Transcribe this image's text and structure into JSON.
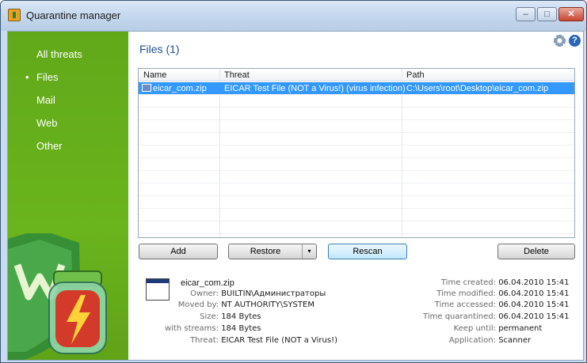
{
  "window": {
    "title": "Quarantine manager",
    "min": "–",
    "max": "□",
    "close": "✕"
  },
  "sidebar": {
    "items": [
      {
        "label": "All threats"
      },
      {
        "label": "Files",
        "bullet": "•"
      },
      {
        "label": "Mail"
      },
      {
        "label": "Web"
      },
      {
        "label": "Other"
      }
    ]
  },
  "main": {
    "title": "Files (1)",
    "help": "?",
    "columns": [
      "Name",
      "Threat",
      "Path"
    ],
    "rows": [
      {
        "name": "eicar_com.zip",
        "threat": "EICAR Test File (NOT a Virus!) (virus infection)",
        "path": "C:\\Users\\root\\Desktop\\eicar_com.zip"
      }
    ],
    "buttons": {
      "add": "Add",
      "restore": "Restore",
      "restore_arrow": "▾",
      "rescan": "Rescan",
      "delete": "Delete"
    }
  },
  "details": {
    "filename": "eicar_com.zip",
    "owner_label": "Owner:",
    "owner": "BUILTIN\\Администраторы",
    "moved_label": "Moved by:",
    "moved": "NT AUTHORITY\\SYSTEM",
    "size_label": "Size:",
    "size": "184 Bytes",
    "streams_label": "with streams:",
    "streams": "184 Bytes",
    "threat_label": "Threat:",
    "threat": "EICAR Test File (NOT a Virus!)",
    "created_label": "Time created:",
    "created": "06.04.2010 15:41",
    "modified_label": "Time modified:",
    "modified": "06.04.2010 15:41",
    "accessed_label": "Time accessed:",
    "accessed": "06.04.2010 15:41",
    "quarantined_label": "Time quarantined:",
    "quarantined": "06.04.2010 15:41",
    "keep_label": "Keep until:",
    "keep": "permanent",
    "app_label": "Application:",
    "app": "Scanner"
  },
  "colors": {
    "sidebar": "#66ae1b",
    "selection": "#3399ff",
    "title_blue": "#1f4f8f"
  }
}
